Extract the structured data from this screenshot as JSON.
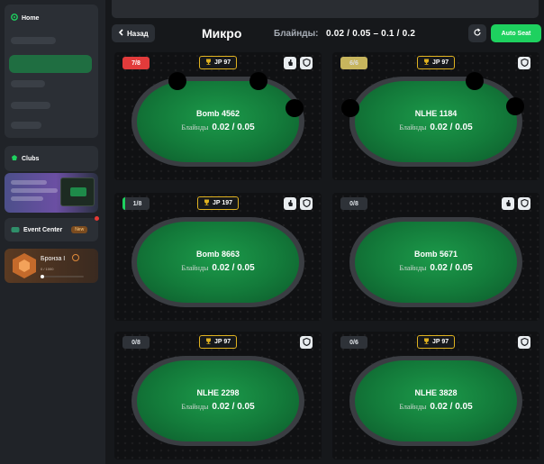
{
  "sidebar": {
    "home_label": "Home",
    "clubs_label": "Clubs",
    "event_label": "Event Center",
    "event_badge": "New",
    "rank_title": "Бронза I",
    "rank_progress": "0 / 1000"
  },
  "header": {
    "back_label": "Назад",
    "title": "Микро",
    "blinds_label": "Блайнды:",
    "blinds_value": "0.02 / 0.05 –  0.1 / 0.2",
    "autoseat_label": "Auto Seat"
  },
  "tables": [
    {
      "name": "Bomb 4562",
      "blinds_label": "Блайнды",
      "blinds": "0.02 / 0.05",
      "seats": "7/8",
      "jp": "JP 97",
      "badge": "red"
    },
    {
      "name": "NLHE 1184",
      "blinds_label": "Блайнды",
      "blinds": "0.02 / 0.05",
      "seats": "6/6",
      "jp": "JP 97",
      "badge": "yellow"
    },
    {
      "name": "Bomb 8663",
      "blinds_label": "Блайнды",
      "blinds": "0.02 / 0.05",
      "seats": "1/8",
      "jp": "JP 197",
      "badge": "green"
    },
    {
      "name": "Bomb 5671",
      "blinds_label": "Блайнды",
      "blinds": "0.02 / 0.05",
      "seats": "0/8",
      "jp": "JP 97",
      "badge": "plain"
    },
    {
      "name": "NLHE 2298",
      "blinds_label": "Блайнды",
      "blinds": "0.02 / 0.05",
      "seats": "0/8",
      "jp": "JP 97",
      "badge": "plain"
    },
    {
      "name": "NLHE 3828",
      "blinds_label": "Блайнды",
      "blinds": "0.02 / 0.05",
      "seats": "0/6",
      "jp": "JP 97",
      "badge": "plain"
    }
  ],
  "colors": {
    "accent": "#1ed15f",
    "jackpot_border": "#e0b220",
    "seat_full": "#e23b3b"
  },
  "icons": [
    "home-icon",
    "clubs-icon",
    "event-icon",
    "rank-icon",
    "back-chevron-icon",
    "refresh-icon",
    "trophy-icon",
    "bomb-hand-icon",
    "shield-icon"
  ]
}
